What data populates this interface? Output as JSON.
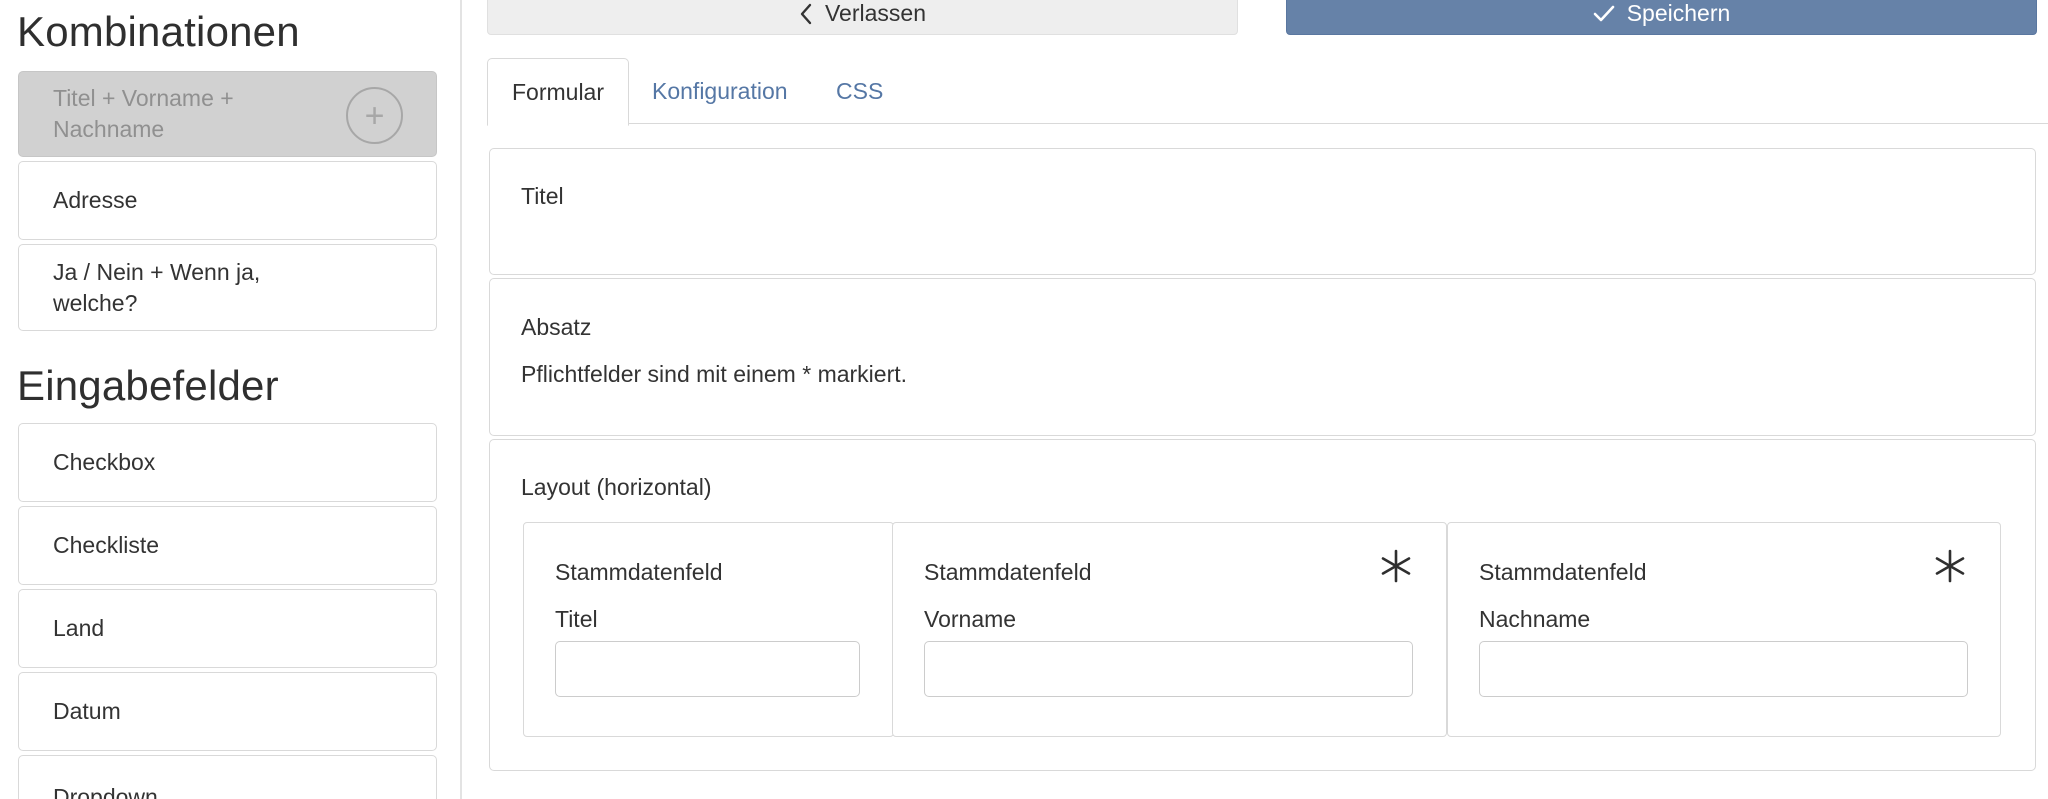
{
  "sidebar": {
    "combinations_heading": "Kombinationen",
    "combinations": [
      {
        "label": "Titel + Vorname + Nachname",
        "state": "dragging",
        "action_icon": "plus-circle-icon"
      },
      {
        "label": "Adresse"
      },
      {
        "label": "Ja / Nein + Wenn ja, welche?"
      }
    ],
    "inputs_heading": "Eingabefelder",
    "inputs": [
      {
        "label": "Checkbox"
      },
      {
        "label": "Checkliste"
      },
      {
        "label": "Land"
      },
      {
        "label": "Datum"
      },
      {
        "label": "Dropdown"
      }
    ]
  },
  "header": {
    "leave_label": "Verlassen",
    "leave_icon": "chevron-left-icon",
    "save_label": "Speichern",
    "save_icon": "checkmark-icon",
    "save_color": "#6682a8"
  },
  "tabs": [
    {
      "label": "Formular",
      "active": true
    },
    {
      "label": "Konfiguration",
      "active": false
    },
    {
      "label": "CSS",
      "active": false
    }
  ],
  "form": {
    "title_block": {
      "type": "Titel"
    },
    "paragraph_block": {
      "type": "Absatz",
      "text": "Pflichtfelder sind mit einem * markiert."
    },
    "layout_block": {
      "type": "Layout (horizontal)",
      "fields": [
        {
          "type": "Stammdatenfeld",
          "label": "Titel",
          "required": false,
          "value": ""
        },
        {
          "type": "Stammdatenfeld",
          "label": "Vorname",
          "required": true,
          "value": ""
        },
        {
          "type": "Stammdatenfeld",
          "label": "Nachname",
          "required": true,
          "value": ""
        }
      ]
    }
  },
  "colors": {
    "accent": "#6682a8",
    "link": "#5577a5",
    "border": "#d9d9d9",
    "dragging_bg": "#d1d1d1"
  }
}
